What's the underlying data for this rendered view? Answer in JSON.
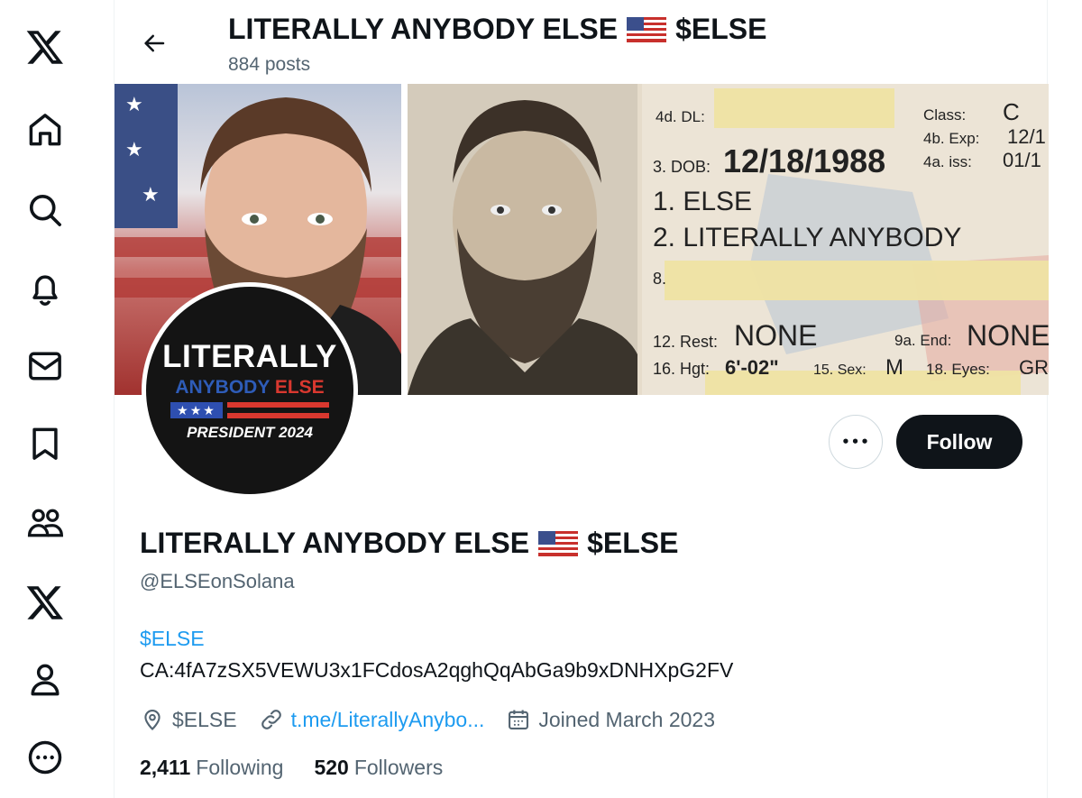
{
  "nav": {
    "items": [
      {
        "icon": "x-logo-icon"
      },
      {
        "icon": "home-icon"
      },
      {
        "icon": "search-icon"
      },
      {
        "icon": "bell-icon"
      },
      {
        "icon": "mail-icon"
      },
      {
        "icon": "bookmark-icon"
      },
      {
        "icon": "communities-icon"
      },
      {
        "icon": "premium-x-icon"
      },
      {
        "icon": "profile-icon"
      },
      {
        "icon": "more-icon"
      }
    ]
  },
  "header": {
    "title": "LITERALLY ANYBODY ELSE",
    "title_suffix": "$ELSE",
    "posts": "884 posts"
  },
  "banner": {
    "license": {
      "dl_label": "4d. DL:",
      "class_label": "Class:",
      "class_value": "C",
      "exp_label": "4b. Exp:",
      "exp_value": "12/1",
      "iss_label": "4a. iss:",
      "iss_value": "01/1",
      "dob_label": "3. DOB:",
      "dob_value": "12/18/1988",
      "line1": "1. ELSE",
      "line2": "2. LITERALLY ANYBODY",
      "line8": "8.",
      "rest_label": "12. Rest:",
      "rest_value": "NONE",
      "end_label": "9a. End:",
      "end_value": "NONE",
      "hgt_label": "16. Hgt:",
      "hgt_value": "6'-02\"",
      "sex_label": "15. Sex:",
      "sex_value": "M",
      "eyes_label": "18. Eyes:",
      "eyes_value": "GR"
    }
  },
  "avatar": {
    "line1": "LITERALLY",
    "line2a": "ANYBODY",
    "line2b": "ELSE",
    "stars": "★★★",
    "line3": "PRESIDENT 2024"
  },
  "actions": {
    "more_glyph": "•••",
    "follow_label": "Follow"
  },
  "profile": {
    "name": "LITERALLY ANYBODY ELSE",
    "name_suffix": "$ELSE",
    "handle": "@ELSEonSolana",
    "bio_link": "$ELSE",
    "bio_ca": "CA:4fA7zSX5VEWU3x1FCdosA2qghQqAbGa9b9xDNHXpG2FV",
    "location": "$ELSE",
    "website": "t.me/LiterallyAnybo...",
    "joined": "Joined March 2023",
    "following_count": "2,411",
    "following_label": "Following",
    "followers_count": "520",
    "followers_label": "Followers"
  },
  "colors": {
    "accent": "#1d9bf0",
    "text": "#0f1419",
    "muted": "#536471",
    "button": "#0f1419"
  }
}
